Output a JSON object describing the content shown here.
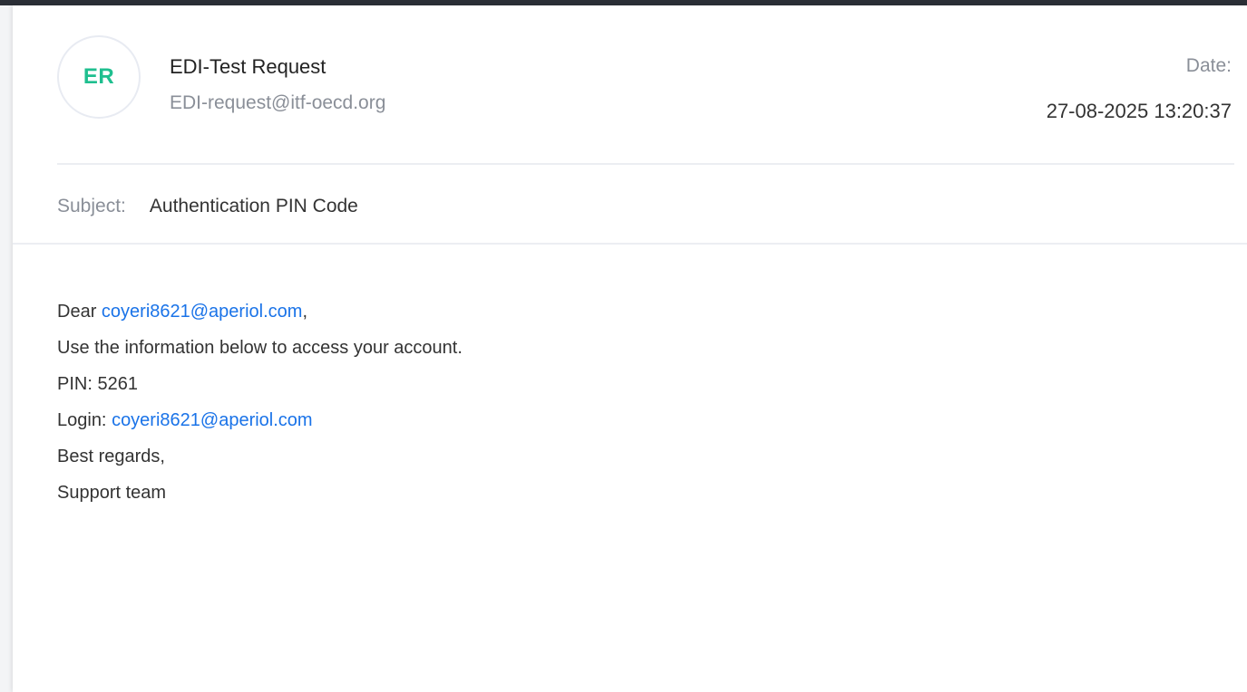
{
  "sender": {
    "initials": "ER",
    "name": "EDI-Test Request",
    "email": "EDI-request@itf-oecd.org"
  },
  "date": {
    "label": "Date:",
    "value": "27-08-2025 13:20:37"
  },
  "subject": {
    "label": "Subject:",
    "value": "Authentication PIN Code"
  },
  "body": {
    "greeting_prefix": "Dear ",
    "greeting_email": "coyeri8621@aperiol.com",
    "greeting_suffix": ",",
    "line_info": "Use the information below to access your account.",
    "line_pin": "PIN: 5261",
    "login_prefix": "Login: ",
    "login_email": "coyeri8621@aperiol.com",
    "line_regards": "Best regards,",
    "line_signature": "Support team"
  },
  "colors": {
    "avatar_text": "#1fbf8f",
    "link": "#1a73e8",
    "top_bar": "#2b2f36"
  }
}
